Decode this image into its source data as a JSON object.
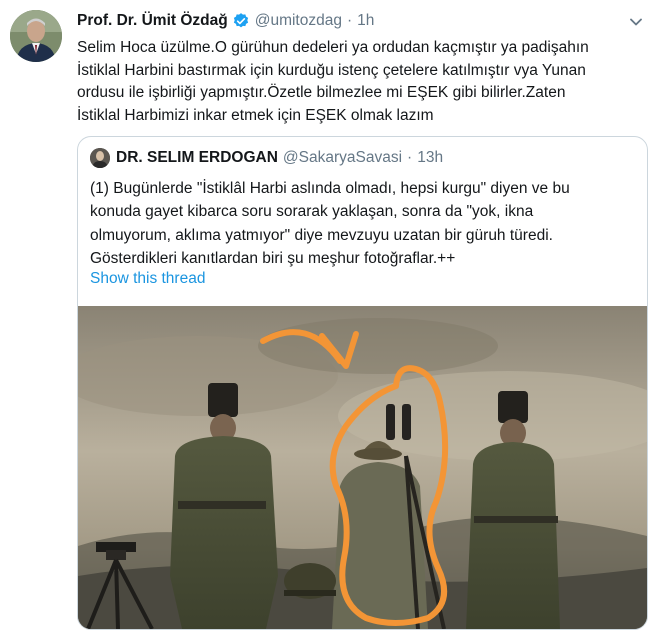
{
  "tweet": {
    "author_name": "Prof. Dr. Ümit Özdağ",
    "handle": "@umitozdag",
    "separator": "·",
    "time": "1h",
    "verified_icon": "verified-badge-icon",
    "menu_icon": "chevron-down-icon",
    "text_lines": [
      "Selim Hoca üzülme.O gürühun dedeleri ya ordudan kaçmıştır ya padişahın",
      "İstiklal Harbini bastırmak için kurduğu istenç çetelere katılmıştır vya Yunan",
      "ordusu ile işbirliği yapmıştır.Özetle bilmezlee mi EŞEK gibi bilirler.Zaten",
      "İstiklal Harbimizi inkar etmek için EŞEK olmak lazım"
    ]
  },
  "quoted": {
    "author_name": "DR. SELIM ERDOGAN",
    "handle": "@SakaryaSavasi",
    "separator": "·",
    "time": "13h",
    "text_lines": [
      "(1) Bugünlerde \"İstiklâl Harbi aslında olmadı, hepsi kurgu\" diyen ve bu",
      "konuda gayet kibarca soru sorarak yaklaşan, sonra da \"yok, ikna",
      "olmuyorum, aklıma yatmıyor\" diye mevzuyu uzatan bir güruh türedi.",
      "Gösterdikleri kanıtlardan biri şu meşhur fotoğraflar.++"
    ],
    "thread_link": "Show this thread"
  },
  "colors": {
    "link": "#1b95e0",
    "verified": "#1da1f2",
    "secondary_text": "#657786",
    "annotation": "#f39536"
  }
}
